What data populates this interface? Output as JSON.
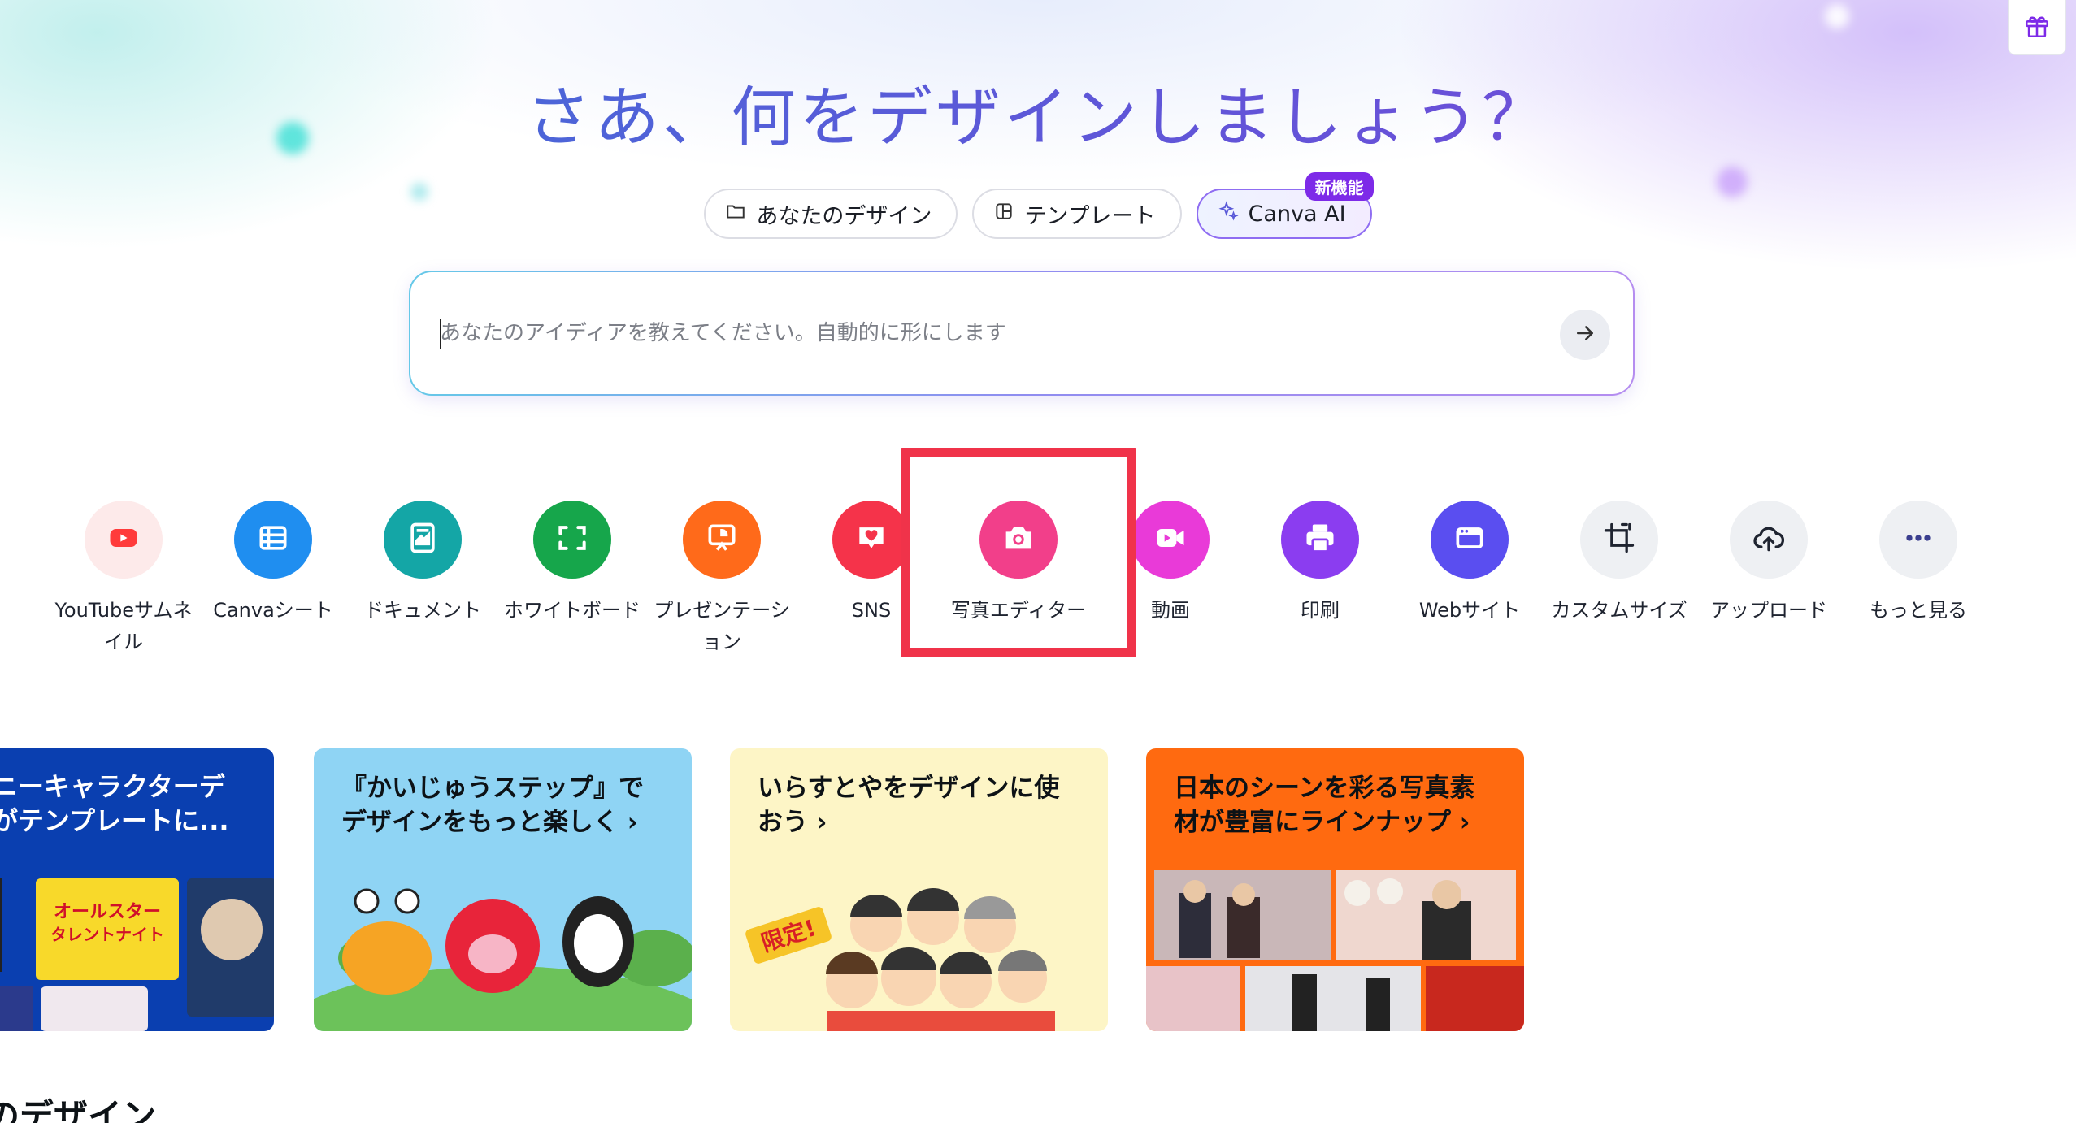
{
  "hero": {
    "headline": "さあ、何をデザインしましょう？",
    "tabs": [
      {
        "label": "あなたのデザイン",
        "icon": "folder-icon"
      },
      {
        "label": "テンプレート",
        "icon": "template-icon"
      },
      {
        "label": "Canva AI",
        "icon": "sparkle-icon",
        "badge": "新機能"
      }
    ]
  },
  "search": {
    "placeholder": "あなたのアイディアを教えてください。自動的に形にします"
  },
  "design_types": [
    {
      "label": "YouTubeサムネイル",
      "icon": "youtube-icon",
      "color": "#fdeaea",
      "icon_color": "#ff3b3b"
    },
    {
      "label": "Canvaシート",
      "icon": "sheet-icon",
      "color": "#1f8ef0",
      "icon_color": "#ffffff"
    },
    {
      "label": "ドキュメント",
      "icon": "document-icon",
      "color": "#14a6a6",
      "icon_color": "#ffffff"
    },
    {
      "label": "ホワイトボード",
      "icon": "whiteboard-icon",
      "color": "#16a64b",
      "icon_color": "#ffffff"
    },
    {
      "label": "プレゼンテーション",
      "icon": "presentation-icon",
      "color": "#ff6a1a",
      "icon_color": "#ffffff"
    },
    {
      "label": "SNS",
      "icon": "heart-icon",
      "color": "#f5334a",
      "icon_color": "#ffffff"
    },
    {
      "label": "写真エディター",
      "icon": "camera-icon",
      "color": "#f23f8a",
      "icon_color": "#ffffff"
    },
    {
      "label": "動画",
      "icon": "video-icon",
      "color": "#e93ad8",
      "icon_color": "#ffffff"
    },
    {
      "label": "印刷",
      "icon": "printer-icon",
      "color": "#8b3df0",
      "icon_color": "#ffffff"
    },
    {
      "label": "Webサイト",
      "icon": "website-icon",
      "color": "#5a4ef0",
      "icon_color": "#ffffff"
    },
    {
      "label": "カスタムサイズ",
      "icon": "resize-icon",
      "color": "#eef0f3",
      "icon_color": "#1f2430"
    },
    {
      "label": "アップロード",
      "icon": "upload-cloud-icon",
      "color": "#eef0f3",
      "icon_color": "#1f2430"
    },
    {
      "label": "もっと見る",
      "icon": "more-icon",
      "color": "#eef0f3",
      "icon_color": "#1f2430"
    }
  ],
  "promo_cards": [
    {
      "title": "ニーキャラクターデ\nがテンプレートに...",
      "bg": "#0a3fb0",
      "text_color": "#ffffff"
    },
    {
      "title": "『かいじゅうステップ』で\nデザインをもっと楽しく ›",
      "bg": "#8fd4f4",
      "text_color": "#1a1a1a"
    },
    {
      "title": "いらすとやをデザインに使\nおう ›",
      "bg": "#fdf5c6",
      "text_color": "#1a1a1a"
    },
    {
      "title": "日本のシーンを彩る写真素\n材が豊富にラインナップ ›",
      "bg": "#ff6a10",
      "text_color": "#1a1a1a"
    }
  ],
  "section": {
    "title": "のデザイン"
  }
}
